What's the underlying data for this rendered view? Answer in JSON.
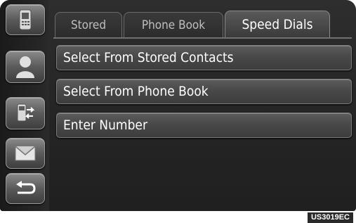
{
  "tabs": [
    {
      "label": "Stored",
      "active": false
    },
    {
      "label": "Phone Book",
      "active": false
    },
    {
      "label": "Speed Dials",
      "active": true
    }
  ],
  "menu": {
    "items": [
      {
        "label": "Select From Stored Contacts"
      },
      {
        "label": "Select From Phone Book"
      },
      {
        "label": "Enter Number"
      }
    ]
  },
  "sidebar": {
    "items": [
      {
        "icon": "phone-icon"
      },
      {
        "icon": "contact-person-icon"
      },
      {
        "icon": "phone-transfer-icon"
      },
      {
        "icon": "envelope-icon"
      },
      {
        "icon": "back-arrow-icon"
      }
    ]
  },
  "figure_code": "US3019EC",
  "colors": {
    "background": "#262626",
    "button": "#4a4a4a",
    "text": "#ffffff",
    "inactive_tab_text": "#bfbfbf"
  }
}
